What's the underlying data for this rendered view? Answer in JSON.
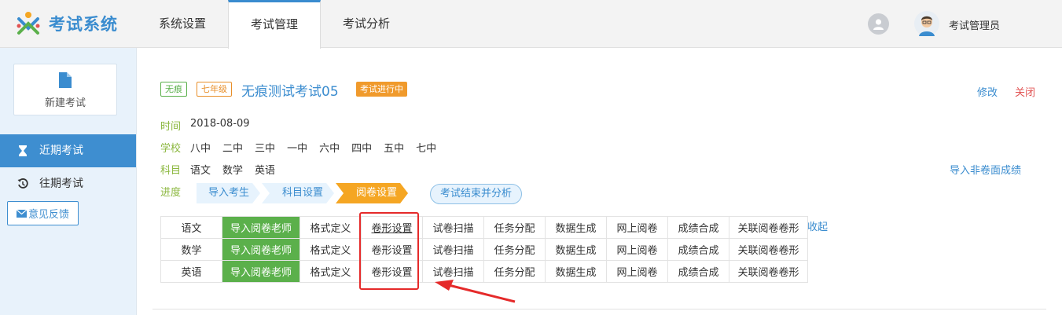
{
  "header": {
    "logo_text": "考试系统",
    "nav": [
      "系统设置",
      "考试管理",
      "考试分析"
    ],
    "user_name": "考试管理员"
  },
  "sidebar": {
    "new_exam": "新建考试",
    "items": [
      {
        "label": "近期考试",
        "icon": "hourglass-icon",
        "active": true
      },
      {
        "label": "往期考试",
        "icon": "history-icon",
        "active": false
      }
    ],
    "feedback": "意见反馈"
  },
  "exam": {
    "tag1": "无痕",
    "tag2": "七年级",
    "title": "无痕测试考试05",
    "status": "考试进行中",
    "edit": "修改",
    "close": "关闭",
    "import_link": "导入非卷面成绩",
    "time_label": "时间",
    "time_value": "2018-08-09",
    "school_label": "学校",
    "schools": [
      "八中",
      "二中",
      "三中",
      "一中",
      "六中",
      "四中",
      "五中",
      "七中"
    ],
    "subject_label": "科目",
    "subjects": [
      "语文",
      "数学",
      "英语"
    ],
    "progress_label": "进度",
    "steps": [
      "导入考生",
      "科目设置",
      "阅卷设置"
    ],
    "active_step": 2,
    "end_step": "考试结束并分析",
    "collapse": "收起"
  },
  "table": {
    "rows": [
      [
        "语文",
        "导入阅卷老师",
        "格式定义",
        "卷形设置",
        "试卷扫描",
        "任务分配",
        "数据生成",
        "网上阅卷",
        "成绩合成",
        "关联阅卷卷形"
      ],
      [
        "数学",
        "导入阅卷老师",
        "格式定义",
        "卷形设置",
        "试卷扫描",
        "任务分配",
        "数据生成",
        "网上阅卷",
        "成绩合成",
        "关联阅卷卷形"
      ],
      [
        "英语",
        "导入阅卷老师",
        "格式定义",
        "卷形设置",
        "试卷扫描",
        "任务分配",
        "数据生成",
        "网上阅卷",
        "成绩合成",
        "关联阅卷卷形"
      ]
    ]
  },
  "colors": {
    "primary": "#3a8ccf",
    "green": "#5bb04b",
    "orange": "#f5a623",
    "red_highlight": "#e52a2a"
  }
}
